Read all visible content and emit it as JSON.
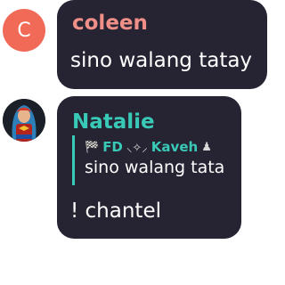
{
  "messages": [
    {
      "avatar_letter": "C",
      "sender": "coleen",
      "text": "sino walang tatay"
    },
    {
      "sender": "Natalie",
      "quote": {
        "display_name": "FD",
        "username": "Kaveh",
        "text": "sino walang tata"
      },
      "text": "! chantel"
    }
  ],
  "colors": {
    "bubble_bg": "#262432",
    "coleen_name": "#ef8f87",
    "natalie_name": "#39c9b7",
    "avatar_c": "#f16a57"
  },
  "icons": [
    "checkered-flag-icon",
    "wings-icon",
    "chess-pawn-icon"
  ]
}
